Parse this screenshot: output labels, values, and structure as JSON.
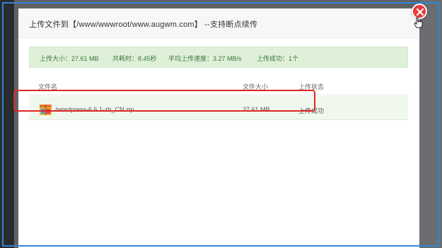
{
  "dialog": {
    "title": "上传文件到【/www/wwwroot/www.augwm.com】 --支持断点续传"
  },
  "summary": {
    "size": "上传大小：27.61 MB",
    "elapsed": "共耗时：8.45秒",
    "speed": "平均上传速度：3.27 MB/s",
    "success": "上传成功：1个"
  },
  "table": {
    "columns": [
      "文件名",
      "文件大小",
      "上传状态"
    ],
    "rows": [
      {
        "name": "/wordpress-6.6.1-zh_CN.zip",
        "size": "27.61 MB",
        "status": "上传成功"
      }
    ]
  },
  "icons": {
    "close": "close-icon",
    "file": "archive-file-icon",
    "cursor": "hand-cursor-icon"
  },
  "colors": {
    "close_button": "#e43b3b",
    "summary_bg": "#dff0d8",
    "summary_text": "#3c763d",
    "highlight_border": "#e02525",
    "selection_frame": "#2f86d6"
  }
}
